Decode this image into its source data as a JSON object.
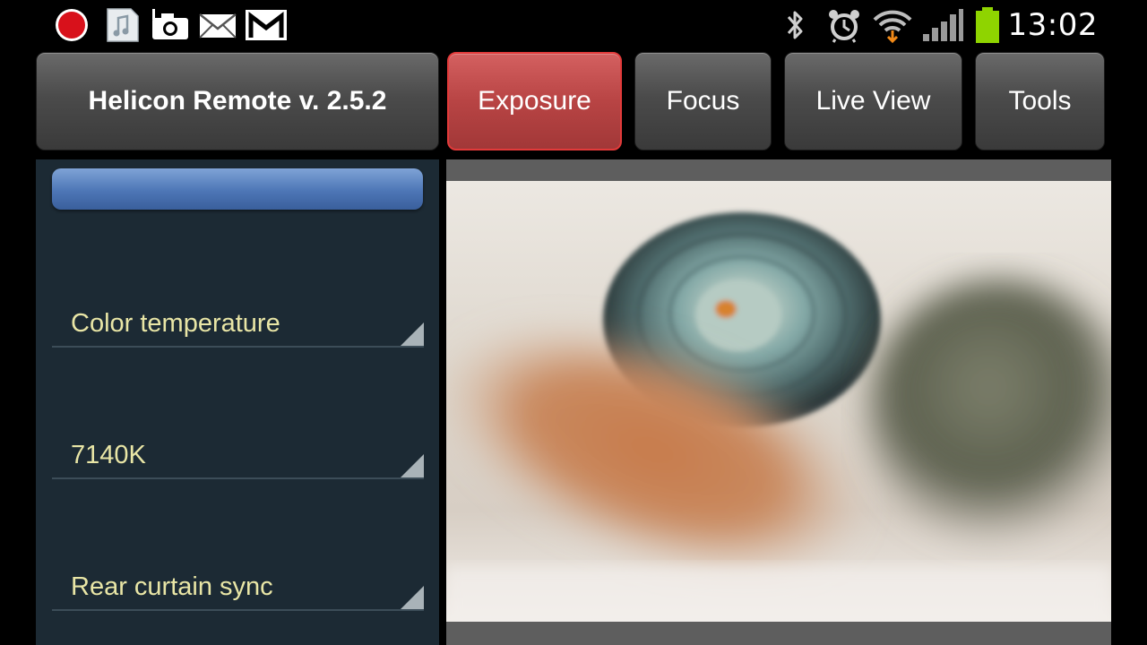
{
  "status_bar": {
    "time": "13:02",
    "left_icons": [
      "record-icon",
      "music-file-icon",
      "camera-icon",
      "email-icon",
      "gmail-icon"
    ],
    "right_icons": [
      "bluetooth-icon",
      "alarm-icon",
      "wifi-icon",
      "signal-icon",
      "battery-icon"
    ]
  },
  "top_bar": {
    "app_title": "Helicon Remote v. 2.5.2",
    "tabs": [
      {
        "label": "Exposure",
        "active": true
      },
      {
        "label": "Focus",
        "active": false
      },
      {
        "label": "Live View",
        "active": false
      },
      {
        "label": "Tools",
        "active": false
      }
    ]
  },
  "settings_panel": {
    "items": [
      {
        "label": "Color temperature"
      },
      {
        "label": "7140K"
      },
      {
        "label": "Rear curtain sync"
      }
    ]
  },
  "colors": {
    "active_tab": "#b84444",
    "panel_bg": "#1c2a34",
    "setting_text": "#e9e6a6",
    "highlight_bar": "#4d76b6"
  }
}
